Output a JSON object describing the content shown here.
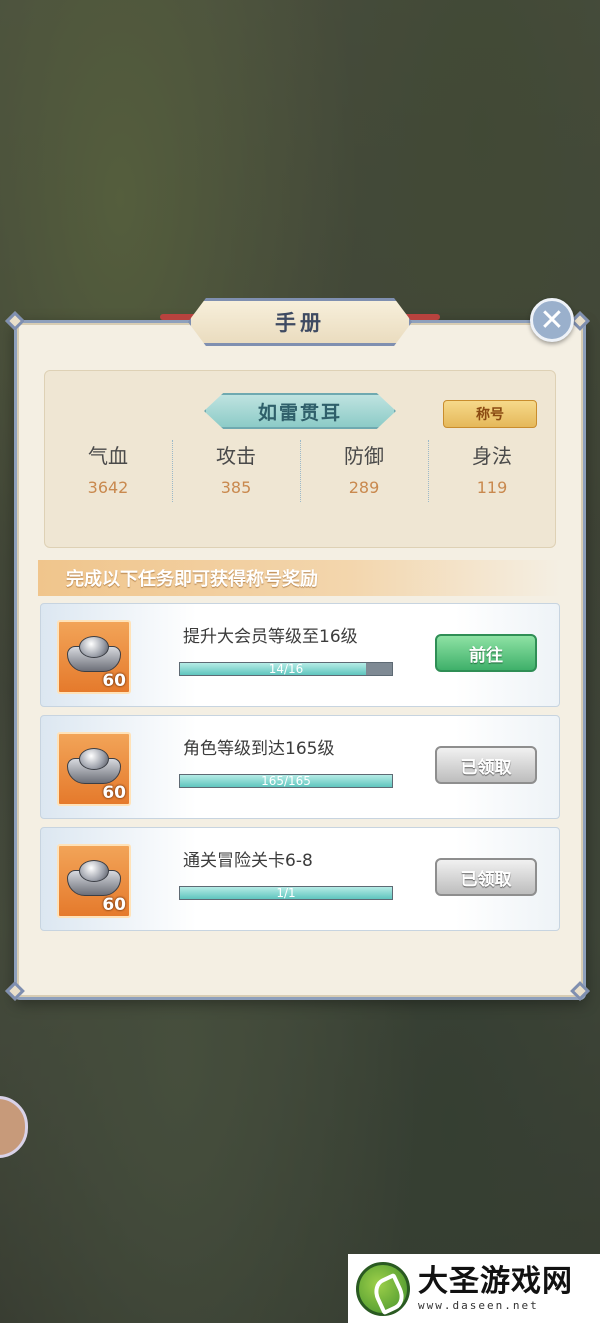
{
  "window": {
    "title": "手册",
    "close_icon": "close-icon"
  },
  "profile": {
    "title_name": "如雷贯耳",
    "rank_tag": "称号",
    "stats": [
      {
        "label": "气血",
        "value": "3642"
      },
      {
        "label": "攻击",
        "value": "385"
      },
      {
        "label": "防御",
        "value": "289"
      },
      {
        "label": "身法",
        "value": "119"
      }
    ]
  },
  "tasks": {
    "header": "完成以下任务即可获得称号奖励",
    "items": [
      {
        "reward_icon": "silver-ingot-icon",
        "reward_qty": "60",
        "desc": "提升大会员等级至16级",
        "progress_text": "14/16",
        "progress": 0.875,
        "button": "前往",
        "state": "go"
      },
      {
        "reward_icon": "silver-ingot-icon",
        "reward_qty": "60",
        "desc": "角色等级到达165级",
        "progress_text": "165/165",
        "progress": 1.0,
        "button": "已领取",
        "state": "done"
      },
      {
        "reward_icon": "silver-ingot-icon",
        "reward_qty": "60",
        "desc": "通关冒险关卡6-8",
        "progress_text": "1/1",
        "progress": 1.0,
        "button": "已领取",
        "state": "done"
      }
    ]
  },
  "watermark": {
    "name": "大圣游戏网",
    "url": "www.daseen.net"
  },
  "colors": {
    "panel_bg": "#f4efe3",
    "panel_border": "#8ea0bc",
    "progress_fill": "#5fc5be",
    "go_button": "#3fb06a",
    "stat_value": "#c9894e"
  }
}
